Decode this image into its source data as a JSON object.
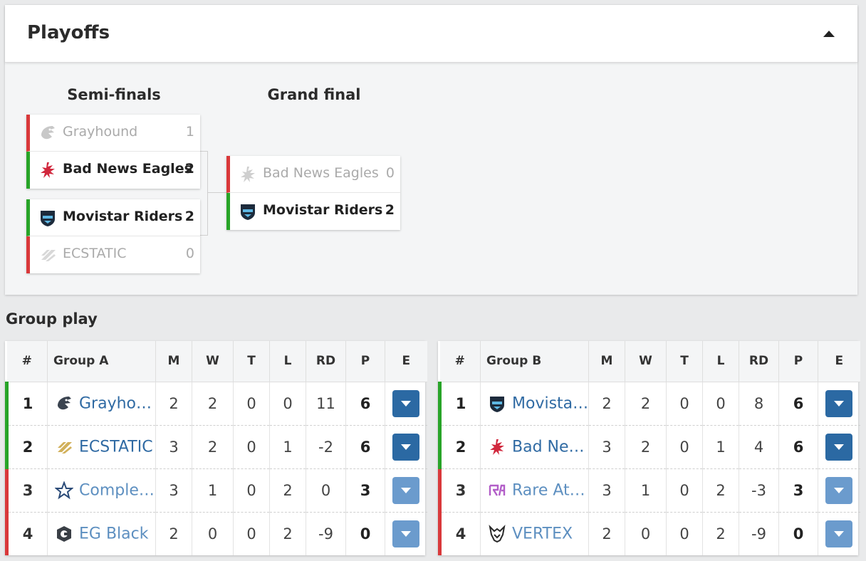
{
  "playoffs": {
    "title": "Playoffs",
    "rounds": [
      {
        "title": "Semi-finals"
      },
      {
        "title": "Grand final"
      }
    ],
    "matches": [
      {
        "top": {
          "team": "Grayhound",
          "score": "1",
          "win": false,
          "logo": "grayhound-logo"
        },
        "bottom": {
          "team": "Bad News Eagles",
          "score": "2",
          "win": true,
          "logo": "bad-news-eagles-logo"
        }
      },
      {
        "top": {
          "team": "Movistar Riders",
          "score": "2",
          "win": true,
          "logo": "movistar-riders-logo"
        },
        "bottom": {
          "team": "ECSTATIC",
          "score": "0",
          "win": false,
          "logo": "ecstatic-logo"
        }
      },
      {
        "top": {
          "team": "Bad News Eagles",
          "score": "0",
          "win": false,
          "logo": "bad-news-eagles-logo"
        },
        "bottom": {
          "team": "Movistar Riders",
          "score": "2",
          "win": true,
          "logo": "movistar-riders-logo"
        }
      }
    ]
  },
  "group_play": {
    "title": "Group play",
    "columns": [
      "#",
      "M",
      "W",
      "T",
      "L",
      "RD",
      "P",
      "E"
    ],
    "groups": [
      {
        "name": "Group A",
        "rows": [
          {
            "rank": "1",
            "team": "Grayho…",
            "m": "2",
            "w": "2",
            "t": "0",
            "l": "0",
            "rd": "11",
            "p": "6"
          },
          {
            "rank": "2",
            "team": "ECSTATIC",
            "m": "3",
            "w": "2",
            "t": "0",
            "l": "1",
            "rd": "-2",
            "p": "6"
          },
          {
            "rank": "3",
            "team": "Comple…",
            "m": "3",
            "w": "1",
            "t": "0",
            "l": "2",
            "rd": "0",
            "p": "3"
          },
          {
            "rank": "4",
            "team": "EG Black",
            "m": "2",
            "w": "0",
            "t": "0",
            "l": "2",
            "rd": "-9",
            "p": "0"
          }
        ]
      },
      {
        "name": "Group B",
        "rows": [
          {
            "rank": "1",
            "team": "Movista…",
            "m": "2",
            "w": "2",
            "t": "0",
            "l": "0",
            "rd": "8",
            "p": "6"
          },
          {
            "rank": "2",
            "team": "Bad Ne…",
            "m": "3",
            "w": "2",
            "t": "0",
            "l": "1",
            "rd": "4",
            "p": "6"
          },
          {
            "rank": "3",
            "team": "Rare At…",
            "m": "3",
            "w": "1",
            "t": "0",
            "l": "2",
            "rd": "-3",
            "p": "3"
          },
          {
            "rank": "4",
            "team": "VERTEX",
            "m": "2",
            "w": "0",
            "t": "0",
            "l": "2",
            "rd": "-9",
            "p": "0"
          }
        ]
      }
    ]
  },
  "colors": {
    "advance": "#28a428",
    "eliminated": "#d9383a",
    "link": "#2f6aa3",
    "button": "#2b69a3"
  }
}
